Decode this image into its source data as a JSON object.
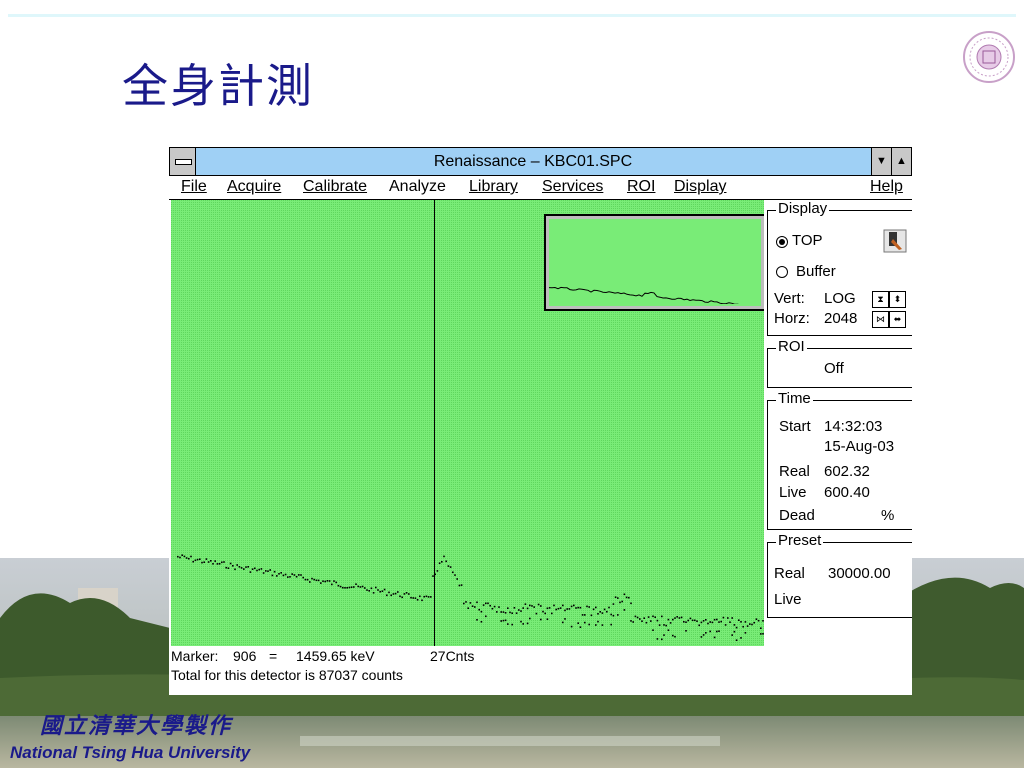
{
  "slide": {
    "title": "全身計測",
    "footer_cn": "國立清華大學製作",
    "footer_en": "National Tsing Hua University"
  },
  "window": {
    "title": "Renaissance  – KBC01.SPC",
    "menu": [
      {
        "label": "File"
      },
      {
        "label": "Acquire"
      },
      {
        "label": "Calibrate"
      },
      {
        "label": "Analyze"
      },
      {
        "label": "Library"
      },
      {
        "label": "Services"
      },
      {
        "label": "ROI"
      },
      {
        "label": "Display"
      },
      {
        "label": "Help"
      }
    ]
  },
  "spectrum": {
    "marker_label": "Marker:",
    "marker_channel": "906",
    "marker_eq": "=",
    "marker_energy": "1459.65  keV",
    "marker_counts": "27Cnts",
    "total_text": "Total for this detector is  87037 counts",
    "background_color": "#79ec77"
  },
  "panel": {
    "display": {
      "title": "Display",
      "opt_top": "TOP",
      "opt_buffer": "Buffer",
      "vert_label": "Vert:",
      "vert_value": "LOG",
      "horz_label": "Horz:",
      "horz_value": "2048"
    },
    "roi": {
      "title": "ROI",
      "value": "Off"
    },
    "time": {
      "title": "Time",
      "start_label": "Start",
      "start_time": "14:32:03",
      "start_date": "15-Aug-03",
      "real_label": "Real",
      "real_value": "602.32",
      "live_label": "Live",
      "live_value": "600.40",
      "dead_label": "Dead",
      "dead_unit": "%"
    },
    "preset": {
      "title": "Preset",
      "real_label": "Real",
      "real_value": "30000.00",
      "live_label": "Live"
    }
  }
}
